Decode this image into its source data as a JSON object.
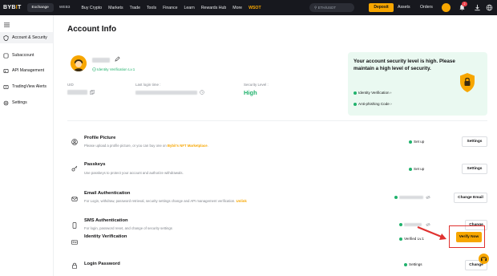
{
  "topbar": {
    "logo_main": "BYB",
    "logo_accent": "I",
    "logo_end": "T",
    "tab_exchange": "Exchange",
    "tab_web3": "WEB3",
    "nav": [
      "Buy Crypto",
      "Markets",
      "Trade",
      "Tools",
      "Finance",
      "Learn",
      "Rewards Hub",
      "More",
      "WSOT"
    ],
    "search_placeholder": "ETH/USDT",
    "deposit_label": "Deposit",
    "assets_label": "Assets",
    "orders_label": "Orders",
    "notif_count": "2",
    "icons": [
      "chevron-down-icon",
      "search-icon",
      "bell-icon",
      "download-icon",
      "globe-icon"
    ]
  },
  "sidebar": {
    "items": [
      {
        "label": "Account & Security",
        "icon": "shield-icon",
        "active": true
      },
      {
        "label": "Subaccount",
        "icon": "subaccount-icon",
        "active": false
      },
      {
        "label": "API Management",
        "icon": "api-icon",
        "active": false
      },
      {
        "label": "TradingView Alerts",
        "icon": "alert-icon",
        "active": false
      },
      {
        "label": "Settings",
        "icon": "gear-icon",
        "active": false
      }
    ]
  },
  "main": {
    "title": "Account Info",
    "verification_tag": "Identity Verification Lv.1",
    "uid_label": "UID",
    "last_login_label": "Last login time :",
    "security_level_label": "Security Level :",
    "security_level_value": "High",
    "security_card": {
      "title": "Your account security level is high. Please maintain a high level of security.",
      "links": [
        "Identity Verification ›",
        "Anti-phishing Code ›"
      ]
    },
    "rows": [
      {
        "title": "Profile Picture",
        "desc": "Please upload a profile picture, or you can buy one on",
        "desc_link": "Bybit's NFT Marketplace",
        "desc_end": ".",
        "status": "Set up",
        "button": "Settings",
        "icon": "user-icon"
      },
      {
        "title": "Passkeys",
        "desc": "Use passkeys to protect your account and authorize withdrawals.",
        "status": "Set up",
        "button": "Settings",
        "icon": "key-icon"
      },
      {
        "title": "Email Authentication",
        "desc": "For Login, withdraw, password retrieval, security settings change and API management verification.",
        "desc_link": "Unlink",
        "button": "Change Email",
        "icon": "mail-icon"
      },
      {
        "title": "SMS Authentication",
        "desc": "For login, password reset, and change of security settings",
        "button": "Change",
        "icon": "phone-icon"
      },
      {
        "title": "Identity Verification",
        "status": "Verified Lv.1",
        "button": "Verify Now",
        "icon": "id-card-icon"
      },
      {
        "title": "Login Password",
        "status": "Settings",
        "button": "Change",
        "icon": "lock-icon"
      }
    ]
  },
  "colors": {
    "accent": "#f7a600",
    "success": "#20b26c",
    "highlight": "#e0312f",
    "topbar": "#17181e"
  }
}
